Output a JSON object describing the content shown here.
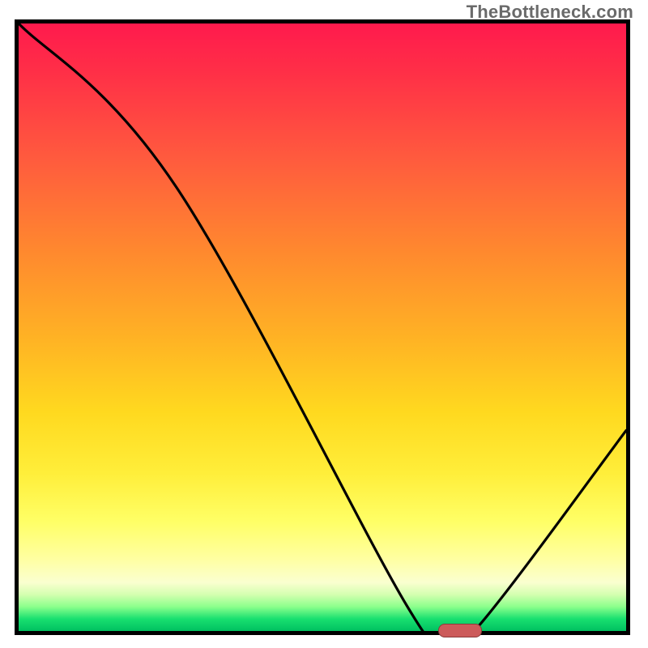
{
  "watermark": "TheBottleneck.com",
  "chart_data": {
    "type": "line",
    "title": "",
    "xlabel": "",
    "ylabel": "",
    "xlim": [
      0,
      100
    ],
    "ylim": [
      0,
      100
    ],
    "grid": false,
    "curve": {
      "x": [
        0,
        26,
        64,
        70,
        75,
        100
      ],
      "y": [
        100,
        73,
        4,
        0,
        0,
        33
      ]
    },
    "marker": {
      "x_start": 69,
      "x_end": 76,
      "y": 0,
      "color": "#cc5a5a"
    },
    "background_gradient_stops": [
      {
        "pos": 0,
        "color": "#ff1a4d"
      },
      {
        "pos": 38,
        "color": "#ff8a2e"
      },
      {
        "pos": 74,
        "color": "#ffee3a"
      },
      {
        "pos": 96,
        "color": "#8cff8c"
      },
      {
        "pos": 100,
        "color": "#00c060"
      }
    ]
  }
}
